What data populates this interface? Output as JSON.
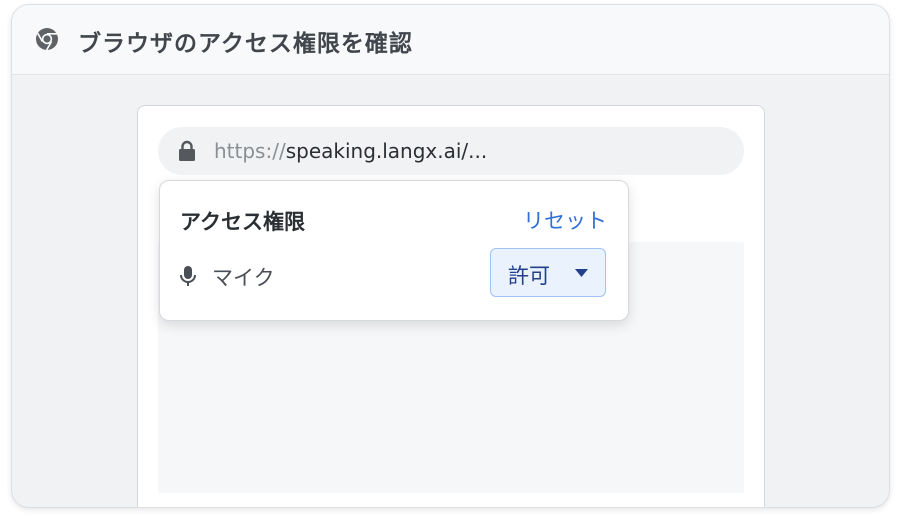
{
  "header": {
    "title": "ブラウザのアクセス権限を確認",
    "icon": "chrome-icon"
  },
  "browser": {
    "url_scheme": "https://",
    "url_rest": "speaking.langx.ai/...",
    "lock_icon": "lock-icon"
  },
  "permissions_popup": {
    "title": "アクセス権限",
    "reset_label": "リセット",
    "permission": {
      "icon": "microphone-icon",
      "label": "マイク",
      "value": "許可"
    }
  },
  "colors": {
    "accent": "#2f6fd6",
    "select_bg": "#eaf2fd",
    "select_border": "#9fc3f3"
  }
}
